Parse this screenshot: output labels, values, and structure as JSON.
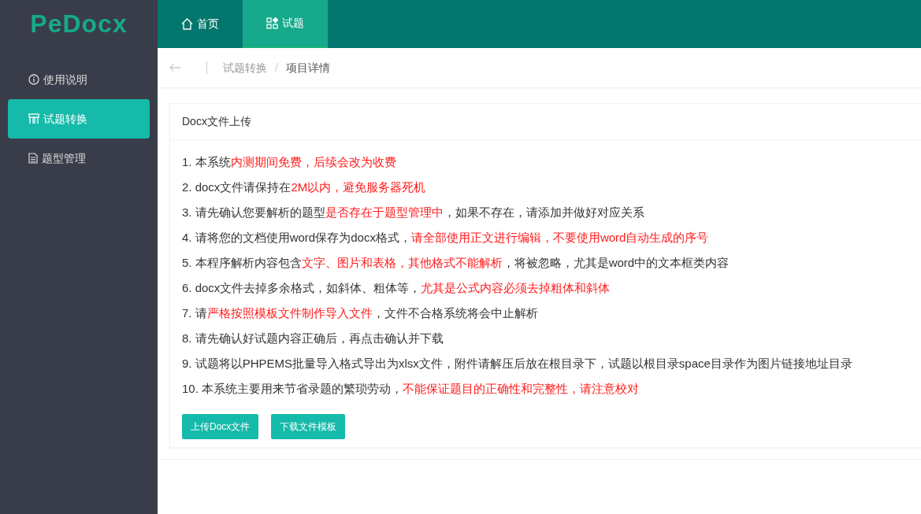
{
  "logo": "PeDocx",
  "sidebar": {
    "items": [
      {
        "label": "使用说明",
        "selected": false
      },
      {
        "label": "试题转换",
        "selected": true
      },
      {
        "label": "题型管理",
        "selected": false
      }
    ]
  },
  "top_nav": {
    "tabs": [
      {
        "label": "首页",
        "selected": false
      },
      {
        "label": "试题",
        "selected": true
      }
    ]
  },
  "breadcrumb": {
    "items": [
      "试题转换",
      "项目详情"
    ],
    "separator": "/"
  },
  "card": {
    "title": "Docx文件上传",
    "instructions": [
      {
        "number": "1.",
        "segments": [
          {
            "text": "本系统",
            "highlighted": false
          },
          {
            "text": "内测期间免费，后续会改为收费",
            "highlighted": true
          }
        ]
      },
      {
        "number": "2.",
        "segments": [
          {
            "text": "docx文件请保持在",
            "highlighted": false
          },
          {
            "text": "2M以内，避免服务器死机",
            "highlighted": true
          }
        ]
      },
      {
        "number": "3.",
        "segments": [
          {
            "text": "请先确认您要解析的题型",
            "highlighted": false
          },
          {
            "text": "是否存在于题型管理中",
            "highlighted": true
          },
          {
            "text": "，如果不存在，请添加并做好对应关系",
            "highlighted": false
          }
        ]
      },
      {
        "number": "4.",
        "segments": [
          {
            "text": "请将您的文档使用word保存为docx格式，",
            "highlighted": false
          },
          {
            "text": "请全部使用正文进行编辑，不要使用word自动生成的序号",
            "highlighted": true
          }
        ]
      },
      {
        "number": "5.",
        "segments": [
          {
            "text": "本程序解析内容包含",
            "highlighted": false
          },
          {
            "text": "文字、图片和表格，其他格式不能解析",
            "highlighted": true
          },
          {
            "text": "，将被忽略，尤其是word中的文本框类内容",
            "highlighted": false
          }
        ]
      },
      {
        "number": "6.",
        "segments": [
          {
            "text": "docx文件去掉多余格式，如斜体、粗体等，",
            "highlighted": false
          },
          {
            "text": "尤其是公式内容必须去掉粗体和斜体",
            "highlighted": true
          }
        ]
      },
      {
        "number": "7.",
        "segments": [
          {
            "text": "请",
            "highlighted": false
          },
          {
            "text": "严格按照模板文件制作导入文件",
            "highlighted": true
          },
          {
            "text": "，文件不合格系统将会中止解析",
            "highlighted": false
          }
        ]
      },
      {
        "number": "8.",
        "segments": [
          {
            "text": "请先确认好试题内容正确后，再点击确认并下载",
            "highlighted": false
          }
        ]
      },
      {
        "number": "9.",
        "segments": [
          {
            "text": "试题将以PHPEMS批量导入格式导出为xlsx文件，附件请解压后放在根目录下，试题以根目录space目录作为图片链接地址目录",
            "highlighted": false
          }
        ]
      },
      {
        "number": "10.",
        "segments": [
          {
            "text": "本系统主要用来节省录题的繁琐劳动，",
            "highlighted": false
          },
          {
            "text": "不能保证题目的正确性和完整性，请注意校对",
            "highlighted": true
          }
        ]
      }
    ],
    "buttons": [
      "上传Docx文件",
      "下载文件模板"
    ]
  }
}
